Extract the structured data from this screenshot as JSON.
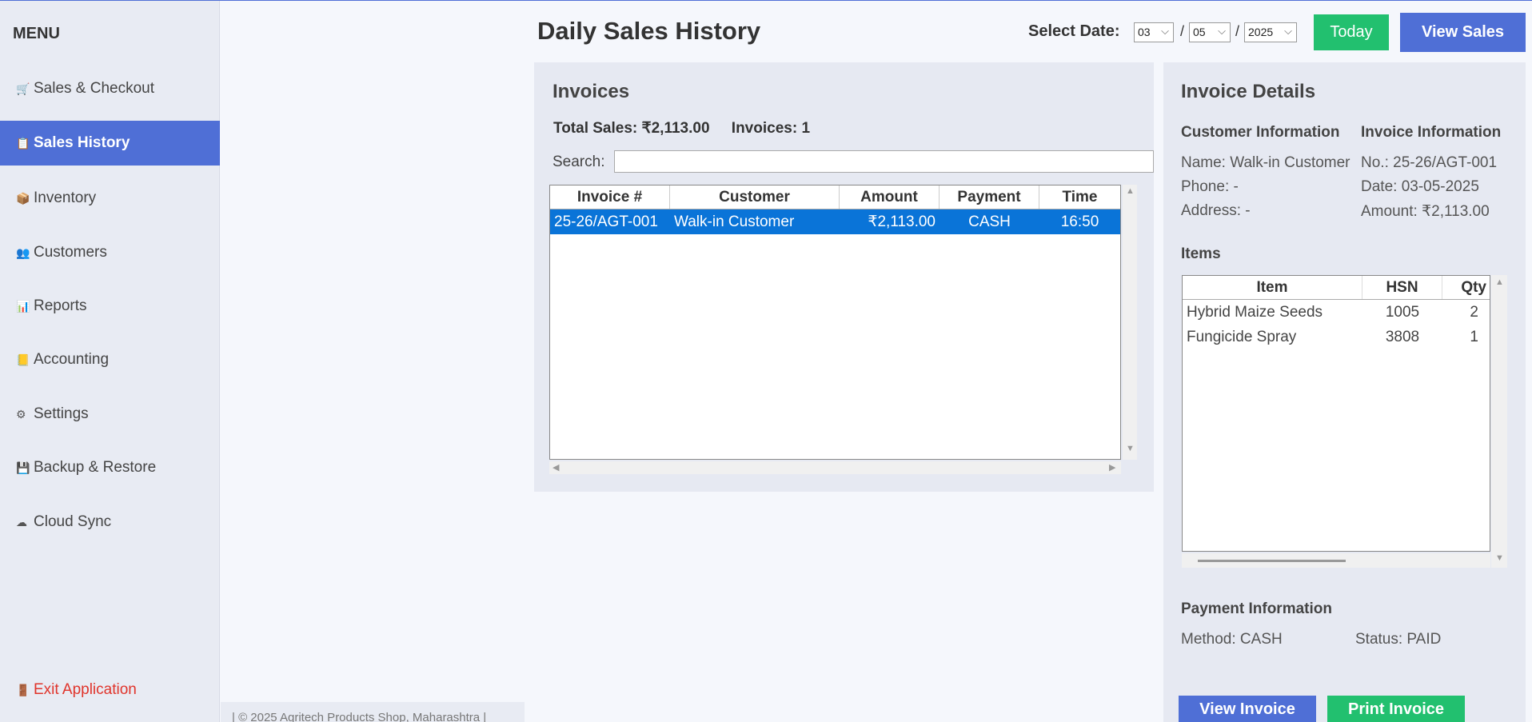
{
  "sidebar": {
    "title": "MENU",
    "items": [
      {
        "label": "Sales & Checkout",
        "icon": "🛒"
      },
      {
        "label": "Sales History",
        "icon": "📋"
      },
      {
        "label": "Inventory",
        "icon": "📦"
      },
      {
        "label": "Customers",
        "icon": "👥"
      },
      {
        "label": "Reports",
        "icon": "📊"
      },
      {
        "label": "Accounting",
        "icon": "📒"
      },
      {
        "label": "Settings",
        "icon": "⚙"
      },
      {
        "label": "Backup & Restore",
        "icon": "💾"
      },
      {
        "label": "Cloud Sync",
        "icon": "☁"
      }
    ],
    "exit": {
      "label": "Exit Application",
      "icon": "🚪"
    }
  },
  "footer": "| © 2025 Agritech Products Shop, Maharashtra |",
  "header": {
    "title": "Daily Sales History",
    "date_label": "Select Date:",
    "day": "03",
    "month": "05",
    "year": "2025",
    "sep": "/",
    "today_label": "Today",
    "view_sales_label": "View Sales"
  },
  "invoices": {
    "title": "Invoices",
    "total_sales": "Total Sales: ₹2,113.00",
    "count": "Invoices: 1",
    "search_label": "Search:",
    "search_value": "",
    "columns": [
      "Invoice #",
      "Customer",
      "Amount",
      "Payment",
      "Time"
    ],
    "rows": [
      {
        "invoice": "25-26/AGT-001",
        "customer": "Walk-in Customer",
        "amount": "₹2,113.00",
        "payment": "CASH",
        "time": "16:50"
      }
    ]
  },
  "details": {
    "title": "Invoice Details",
    "customer_header": "Customer Information",
    "invoice_header": "Invoice Information",
    "name": "Name: Walk-in Customer",
    "phone": "Phone: -",
    "address": "Address: -",
    "number": "No.: 25-26/AGT-001",
    "date": "Date: 03-05-2025",
    "amount": "Amount: ₹2,113.00",
    "items_title": "Items",
    "item_columns": [
      "Item",
      "HSN",
      "Qty"
    ],
    "items": [
      {
        "item": "Hybrid Maize Seeds",
        "hsn": "1005",
        "qty": "2"
      },
      {
        "item": "Fungicide Spray",
        "hsn": "3808",
        "qty": "1"
      }
    ],
    "payment_title": "Payment Information",
    "method": "Method: CASH",
    "status": "Status: PAID",
    "view_invoice_label": "View Invoice",
    "print_invoice_label": "Print Invoice"
  },
  "colors": {
    "accent": "#4f6fd6",
    "success": "#22c06f",
    "selection": "#0a74d8",
    "danger": "#e0342b"
  }
}
